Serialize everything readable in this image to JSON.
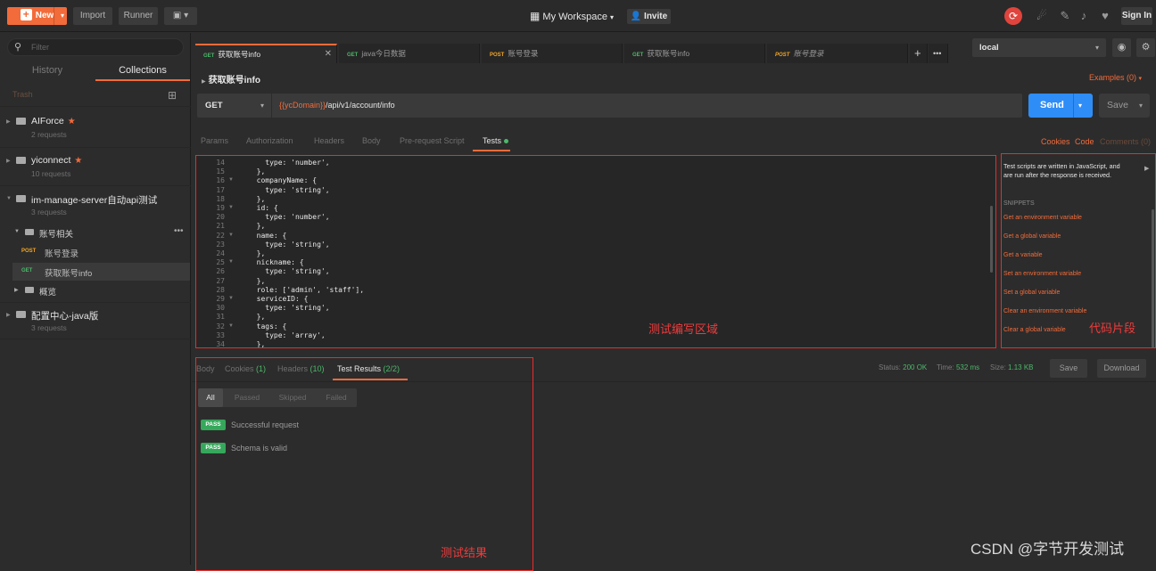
{
  "topbar": {
    "new_label": "New",
    "import_label": "Import",
    "runner_label": "Runner",
    "workspace_label": "My Workspace",
    "invite_label": "Invite",
    "signin_label": "Sign In"
  },
  "sidebar": {
    "filter_placeholder": "Filter",
    "tabs": [
      "History",
      "Collections"
    ],
    "trash_label": "Trash",
    "collections": [
      {
        "name": "AIForce",
        "requests": "2 requests"
      },
      {
        "name": "yiconnect",
        "requests": "10 requests"
      },
      {
        "name": "im-manage-server自动api测试",
        "requests": "3 requests"
      },
      {
        "name": "配置中心-java版",
        "requests": "3 requests"
      }
    ],
    "folders": [
      "账号相关",
      "概览"
    ],
    "requests": [
      {
        "method": "POST",
        "name": "账号登录"
      },
      {
        "method": "GET",
        "name": "获取账号info"
      }
    ]
  },
  "request_tabs": [
    {
      "method": "GET",
      "name": "获取账号info"
    },
    {
      "method": "GET",
      "name": "java今日数据"
    },
    {
      "method": "POST",
      "name": "账号登录"
    },
    {
      "method": "GET",
      "name": "获取账号info"
    },
    {
      "method": "POST",
      "name": "账号登录"
    }
  ],
  "environment": {
    "selected": "local"
  },
  "request": {
    "title": "获取账号info",
    "examples_label": "Examples (0)",
    "method": "GET",
    "url_var": "{{ycDomain}}",
    "url_path": "/api/v1/account/info",
    "send_label": "Send",
    "save_label": "Save"
  },
  "param_tabs": [
    "Params",
    "Authorization",
    "Headers",
    "Body",
    "Pre-request Script",
    "Tests"
  ],
  "right_links": [
    "Cookies",
    "Code",
    "Comments (0)"
  ],
  "editor": {
    "line_numbers": [
      "14",
      "15",
      "16",
      "17",
      "18",
      "19",
      "20",
      "21",
      "22",
      "23",
      "24",
      "25",
      "26",
      "27",
      "28",
      "29",
      "30",
      "31",
      "32",
      "33",
      "34"
    ],
    "fold_markers": [
      "16",
      "19",
      "22",
      "25",
      "29",
      "32"
    ],
    "lines": [
      "    type: 'number',",
      "  },",
      "  companyName: {",
      "    type: 'string',",
      "  },",
      "  id: {",
      "    type: 'number',",
      "  },",
      "  name: {",
      "    type: 'string',",
      "  },",
      "  nickname: {",
      "    type: 'string',",
      "  },",
      "  role: ['admin', 'staff'],",
      "  serviceID: {",
      "    type: 'string',",
      "  },",
      "  tags: {",
      "    type: 'array',",
      "  },"
    ],
    "annotation": "测试编写区域"
  },
  "snippets": {
    "description": "Test scripts are written in JavaScript, and are run after the response is received.",
    "header": "SNIPPETS",
    "items": [
      "Get an environment variable",
      "Get a global variable",
      "Get a variable",
      "Set an environment variable",
      "Set a global variable",
      "Clear an environment variable",
      "Clear a global variable"
    ],
    "annotation": "代码片段"
  },
  "response": {
    "tabs": [
      "Body",
      "Cookies",
      "Headers",
      "Test Results"
    ],
    "cookies_count": "(1)",
    "headers_count": "(10)",
    "test_results_count": "(2/2)",
    "status_label": "Status:",
    "status_value": "200 OK",
    "time_label": "Time:",
    "time_value": "532 ms",
    "size_label": "Size:",
    "size_value": "1.13 KB",
    "save_label": "Save",
    "download_label": "Download",
    "filters": [
      "All",
      "Passed",
      "Skipped",
      "Failed"
    ],
    "results": [
      {
        "badge": "PASS",
        "name": "Successful request"
      },
      {
        "badge": "PASS",
        "name": "Schema is valid"
      }
    ],
    "annotation": "测试结果"
  },
  "watermark": "CSDN @字节开发测试",
  "colors": {
    "accent": "#f26b3a",
    "send": "#2f8df7",
    "pass": "#35a85b",
    "annotation": "#ee2a2a"
  }
}
